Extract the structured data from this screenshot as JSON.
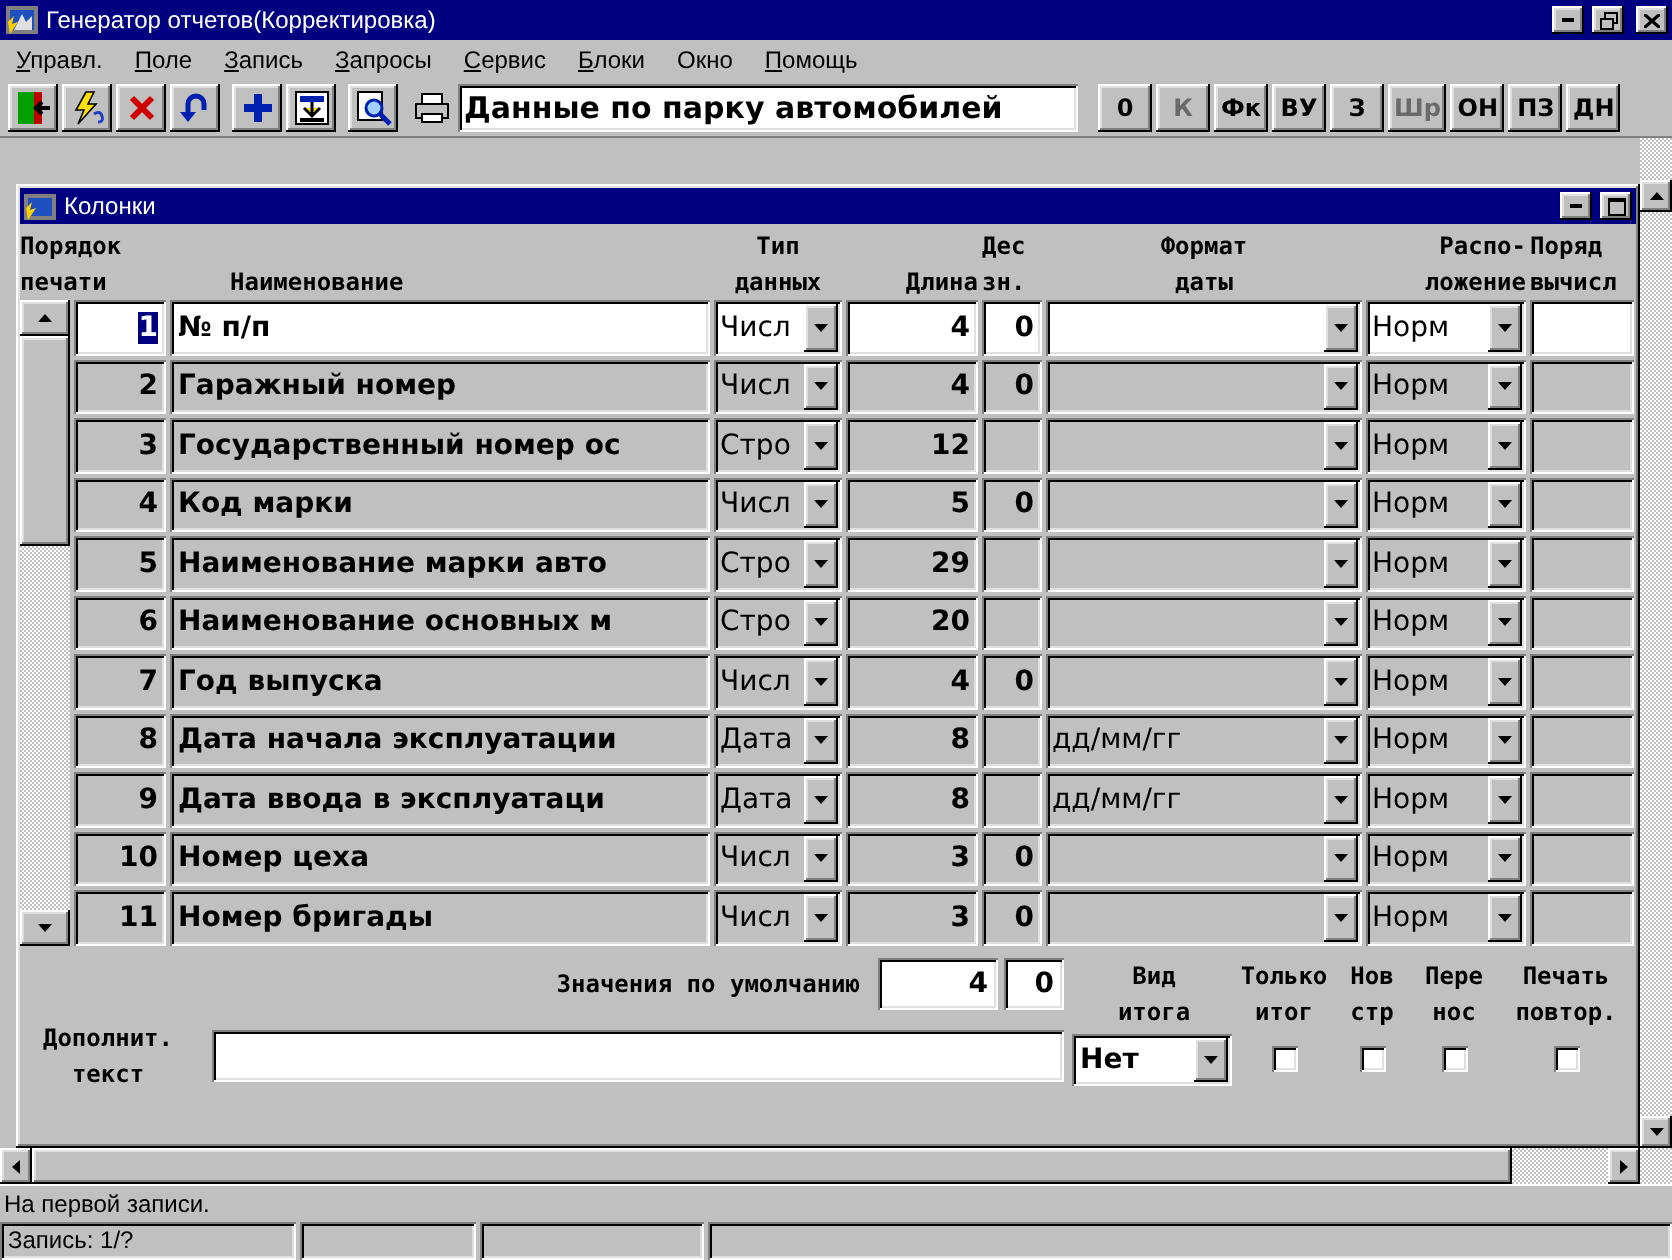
{
  "window": {
    "title": "Генератор отчетов(Корректировка)"
  },
  "menu": [
    {
      "label": "Управл.",
      "underlined": true
    },
    {
      "label": "Поле",
      "underlined": true
    },
    {
      "label": "Запись",
      "underlined": true
    },
    {
      "label": "Запросы",
      "underlined": true
    },
    {
      "label": "Сервис",
      "underlined": true
    },
    {
      "label": "Блоки",
      "underlined": true
    },
    {
      "label": "Окно",
      "underlined": false
    },
    {
      "label": "Помощь",
      "underlined": true
    }
  ],
  "toolbar": {
    "report": "Данные по парку автомобилей",
    "buttons": [
      {
        "label": "0",
        "disabled": false
      },
      {
        "label": "К",
        "disabled": true
      },
      {
        "label": "Фк",
        "disabled": false
      },
      {
        "label": "ВУ",
        "disabled": false
      },
      {
        "label": "З",
        "disabled": false
      },
      {
        "label": "Шр",
        "disabled": true
      },
      {
        "label": "ОН",
        "disabled": false
      },
      {
        "label": "ПЗ",
        "disabled": false
      },
      {
        "label": "ДН",
        "disabled": false
      }
    ]
  },
  "columns_window": {
    "title": "Колонки",
    "headers": [
      "Порядок\nпечати",
      "Наименование",
      "Тип\nданных",
      "Длина",
      "Дес\nзн.",
      "Формат\nдаты",
      "Распо-\nложение",
      "Поряд\nвычисл"
    ],
    "rows": [
      {
        "order": "1",
        "name": "№ п/п",
        "type": "Числ",
        "length": "4",
        "decimals": "0",
        "placement": "Норм",
        "selected": true
      },
      {
        "order": "2",
        "name": "Гаражный номер",
        "type": "Числ",
        "length": "4",
        "decimals": "0",
        "placement": "Норм",
        "selected": false
      },
      {
        "order": "3",
        "name": "Государственный номер ос",
        "type": "Стро",
        "length": "12",
        "placement": "Норм",
        "selected": false
      },
      {
        "order": "4",
        "name": "Код марки",
        "type": "Числ",
        "length": "5",
        "decimals": "0",
        "placement": "Норм",
        "selected": false
      },
      {
        "order": "5",
        "name": "Наименование марки авто",
        "type": "Стро",
        "length": "29",
        "placement": "Норм",
        "selected": false
      },
      {
        "order": "6",
        "name": "Наименование основных м",
        "type": "Стро",
        "length": "20",
        "placement": "Норм",
        "selected": false
      },
      {
        "order": "7",
        "name": "Год выпуска",
        "type": "Числ",
        "length": "4",
        "decimals": "0",
        "placement": "Норм",
        "selected": false
      },
      {
        "order": "8",
        "name": "Дата начала эксплуатации",
        "type": "Дата",
        "length": "8",
        "date_format": "дд/мм/гг",
        "placement": "Норм",
        "selected": false
      },
      {
        "order": "9",
        "name": "Дата ввода в эксплуатаци",
        "type": "Дата",
        "length": "8",
        "date_format": "дд/мм/гг",
        "placement": "Норм",
        "selected": false
      },
      {
        "order": "10",
        "name": "Номер цеха",
        "type": "Числ",
        "length": "3",
        "decimals": "0",
        "placement": "Норм",
        "selected": false
      },
      {
        "order": "11",
        "name": "Номер  бригады",
        "type": "Числ",
        "length": "3",
        "decimals": "0",
        "placement": "Норм",
        "selected": false
      }
    ],
    "defaults": {
      "label": "Значения по умолчанию",
      "length": "4",
      "decimals": "0"
    },
    "extra_text": {
      "label": "Дополнит.\nтекст"
    },
    "options": [
      {
        "label": "Вид\nитога",
        "kind": "select",
        "value": "Нет"
      },
      {
        "label": "Только\nитог",
        "kind": "checkbox",
        "checked": false
      },
      {
        "label": "Нов\nстр",
        "kind": "checkbox",
        "checked": false
      },
      {
        "label": "Пере\nнос",
        "kind": "checkbox",
        "checked": false
      },
      {
        "label": "Печать\nповтор.",
        "kind": "checkbox",
        "checked": false
      }
    ]
  },
  "status_bar": {
    "message": "На первой записи.",
    "record": "Запись: 1/?"
  }
}
